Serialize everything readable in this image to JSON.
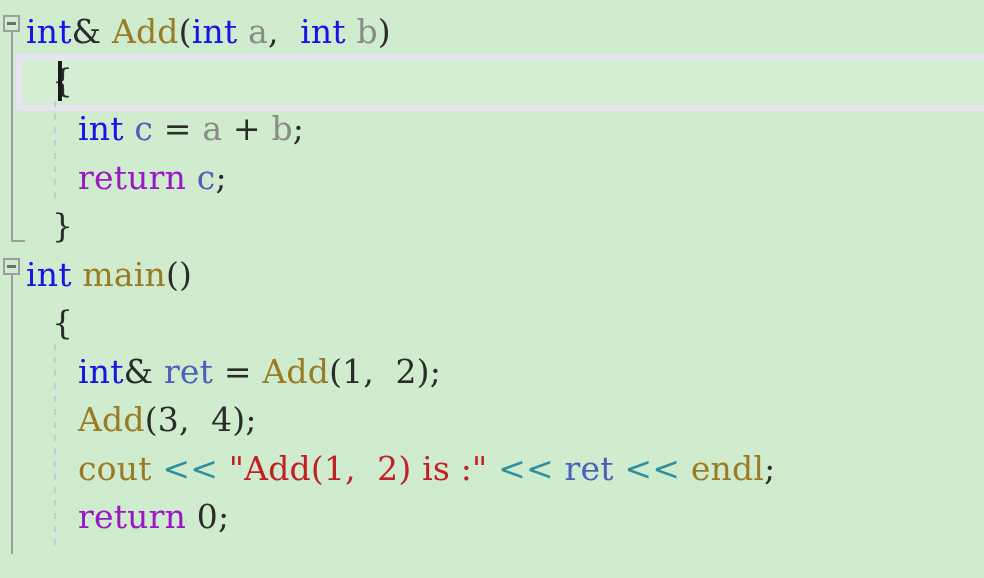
{
  "editor": {
    "language": "C++",
    "background_color": "#cfeccf",
    "current_line_highlight_color": "#e5e4ef",
    "caret_line": 2,
    "colors": {
      "keyword_type": "#1414e6",
      "keyword_control": "#9b18c4",
      "function": "#9a7b24",
      "variable_gray": "#8a8a8a",
      "variable_blue": "#4d5fb8",
      "string": "#c02026",
      "operator_stream": "#2f8f9c",
      "punctuation": "#2b2b2b",
      "fold_marker": "#9e9e9e",
      "indent_guide": "#cbc9d6"
    },
    "fold_markers": [
      {
        "line": 1,
        "state": "expanded",
        "glyph": "minus"
      },
      {
        "line": 6,
        "state": "expanded",
        "glyph": "minus"
      }
    ],
    "lines": [
      {
        "number": 1,
        "indent": 0,
        "text": "int& Add(int a,  int b)",
        "tokens": [
          {
            "t": "int",
            "c": "kw"
          },
          {
            "t": "&",
            "c": "punct"
          },
          {
            "t": " ",
            "c": "punct"
          },
          {
            "t": "Add",
            "c": "fn"
          },
          {
            "t": "(",
            "c": "punct"
          },
          {
            "t": "int",
            "c": "kw"
          },
          {
            "t": " ",
            "c": "punct"
          },
          {
            "t": "a",
            "c": "var"
          },
          {
            "t": ",",
            "c": "punct"
          },
          {
            "t": "  ",
            "c": "punct"
          },
          {
            "t": "int",
            "c": "kw"
          },
          {
            "t": " ",
            "c": "punct"
          },
          {
            "t": "b",
            "c": "var"
          },
          {
            "t": ")",
            "c": "punct"
          }
        ]
      },
      {
        "number": 2,
        "indent": 1,
        "text": "{",
        "tokens": [
          {
            "t": "{",
            "c": "punct"
          }
        ]
      },
      {
        "number": 3,
        "indent": 2,
        "text": "int c = a + b;",
        "tokens": [
          {
            "t": "int",
            "c": "kw"
          },
          {
            "t": " ",
            "c": "punct"
          },
          {
            "t": "c",
            "c": "varb"
          },
          {
            "t": " ",
            "c": "punct"
          },
          {
            "t": "=",
            "c": "punct"
          },
          {
            "t": " ",
            "c": "punct"
          },
          {
            "t": "a",
            "c": "var"
          },
          {
            "t": " ",
            "c": "punct"
          },
          {
            "t": "+",
            "c": "punct"
          },
          {
            "t": " ",
            "c": "punct"
          },
          {
            "t": "b",
            "c": "var"
          },
          {
            "t": ";",
            "c": "punct"
          }
        ]
      },
      {
        "number": 4,
        "indent": 2,
        "text": "return c;",
        "tokens": [
          {
            "t": "return",
            "c": "ctl"
          },
          {
            "t": " ",
            "c": "punct"
          },
          {
            "t": "c",
            "c": "varb"
          },
          {
            "t": ";",
            "c": "punct"
          }
        ]
      },
      {
        "number": 5,
        "indent": 1,
        "text": "}",
        "tokens": [
          {
            "t": "}",
            "c": "punct"
          }
        ]
      },
      {
        "number": 6,
        "indent": 0,
        "text": "int main()",
        "tokens": [
          {
            "t": "int",
            "c": "kw"
          },
          {
            "t": " ",
            "c": "punct"
          },
          {
            "t": "main",
            "c": "fn"
          },
          {
            "t": "()",
            "c": "punct"
          }
        ]
      },
      {
        "number": 7,
        "indent": 1,
        "text": "{",
        "tokens": [
          {
            "t": "{",
            "c": "punct"
          }
        ]
      },
      {
        "number": 8,
        "indent": 2,
        "text": "int& ret = Add(1,  2);",
        "tokens": [
          {
            "t": "int",
            "c": "kw"
          },
          {
            "t": "&",
            "c": "punct"
          },
          {
            "t": " ",
            "c": "punct"
          },
          {
            "t": "ret",
            "c": "varb"
          },
          {
            "t": " ",
            "c": "punct"
          },
          {
            "t": "=",
            "c": "punct"
          },
          {
            "t": " ",
            "c": "punct"
          },
          {
            "t": "Add",
            "c": "fn"
          },
          {
            "t": "(",
            "c": "punct"
          },
          {
            "t": "1",
            "c": "num"
          },
          {
            "t": ",",
            "c": "punct"
          },
          {
            "t": "  ",
            "c": "punct"
          },
          {
            "t": "2",
            "c": "num"
          },
          {
            "t": ");",
            "c": "punct"
          }
        ]
      },
      {
        "number": 9,
        "indent": 2,
        "text": "Add(3,  4);",
        "tokens": [
          {
            "t": "Add",
            "c": "fn"
          },
          {
            "t": "(",
            "c": "punct"
          },
          {
            "t": "3",
            "c": "num"
          },
          {
            "t": ",",
            "c": "punct"
          },
          {
            "t": "  ",
            "c": "punct"
          },
          {
            "t": "4",
            "c": "num"
          },
          {
            "t": ");",
            "c": "punct"
          }
        ]
      },
      {
        "number": 10,
        "indent": 2,
        "text": "cout << \"Add(1,  2) is :\" << ret << endl;",
        "tokens": [
          {
            "t": "cout",
            "c": "fn"
          },
          {
            "t": " ",
            "c": "punct"
          },
          {
            "t": "<<",
            "c": "op"
          },
          {
            "t": " ",
            "c": "punct"
          },
          {
            "t": "\"Add(1,  2) is :\"",
            "c": "str"
          },
          {
            "t": " ",
            "c": "punct"
          },
          {
            "t": "<<",
            "c": "op"
          },
          {
            "t": " ",
            "c": "punct"
          },
          {
            "t": "ret",
            "c": "varb"
          },
          {
            "t": " ",
            "c": "punct"
          },
          {
            "t": "<<",
            "c": "op"
          },
          {
            "t": " ",
            "c": "punct"
          },
          {
            "t": "endl",
            "c": "fn"
          },
          {
            "t": ";",
            "c": "punct"
          }
        ]
      },
      {
        "number": 11,
        "indent": 2,
        "text": "return 0;",
        "tokens": [
          {
            "t": "return",
            "c": "ctl"
          },
          {
            "t": " ",
            "c": "punct"
          },
          {
            "t": "0",
            "c": "num"
          },
          {
            "t": ";",
            "c": "punct"
          }
        ]
      }
    ]
  }
}
